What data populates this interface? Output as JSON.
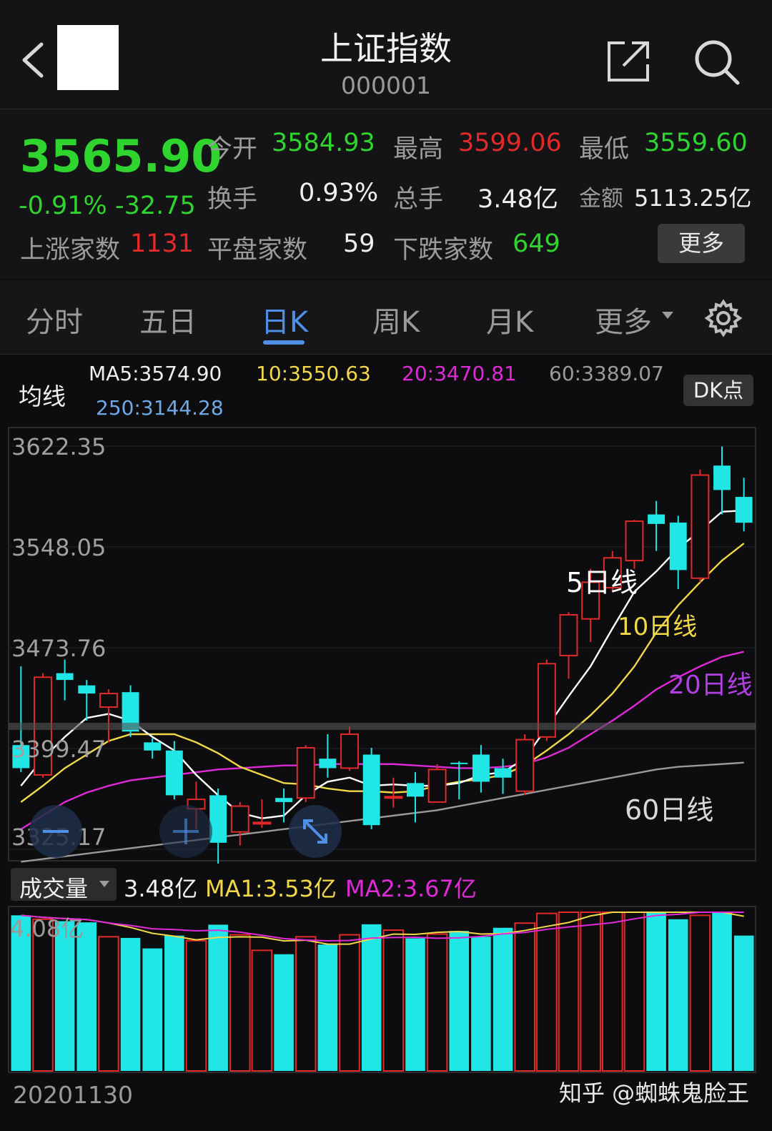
{
  "header": {
    "title": "上证指数",
    "code": "000001"
  },
  "quote": {
    "price": "3565.90",
    "change": "-0.91% -32.75",
    "open_label": "今开",
    "open": "3584.93",
    "high_label": "最高",
    "high": "3599.06",
    "low_label": "最低",
    "low": "3559.60",
    "turnover_label": "换手",
    "turnover": "0.93%",
    "volume_label": "总手",
    "volume": "3.48亿",
    "amount_label": "金额",
    "amount": "5113.25亿",
    "up_label": "上涨家数",
    "up": "1131",
    "flat_label": "平盘家数",
    "flat": "59",
    "down_label": "下跌家数",
    "down": "649",
    "more_label": "更多"
  },
  "tabs": [
    "分时",
    "五日",
    "日K",
    "周K",
    "月K",
    "更多"
  ],
  "active_tab": "日K",
  "ma": {
    "label": "均线",
    "ma5": "MA5:3574.90",
    "ma10": "10:3550.63",
    "ma20": "20:3470.81",
    "ma60": "60:3389.07",
    "ma250": "250:3144.28",
    "dk_label": "DK点"
  },
  "annotations": {
    "ma5": "5日线",
    "ma10": "10日线",
    "ma20": "20日线",
    "ma60": "60日线"
  },
  "volume_panel": {
    "selector": "成交量",
    "current": "3.48亿",
    "ma1": "MA1:3.53亿",
    "ma2": "MA2:3.67亿",
    "max_label": "4.08亿"
  },
  "date_start": "20201130",
  "watermark": "知乎 @蜘蛛鬼脸王",
  "colors": {
    "up": "#e02a2a",
    "down": "#20e6e6",
    "ma5": "#ffffff",
    "ma10": "#f0d848",
    "ma20": "#e02ad8",
    "ma60": "#9a9a9a",
    "ma250": "#6ea8e6",
    "accent": "#4f8fe6"
  },
  "chart_data": {
    "type": "candlestick",
    "y_ticks": [
      "3622.35",
      "3548.05",
      "3473.76",
      "3399.47",
      "3325.17"
    ],
    "ylim": [
      3325.17,
      3622.35
    ],
    "candles": [
      {
        "o": 3402,
        "c": 3385,
        "h": 3460,
        "l": 3382
      },
      {
        "o": 3380,
        "c": 3452,
        "h": 3455,
        "l": 3378
      },
      {
        "o": 3455,
        "c": 3450,
        "h": 3465,
        "l": 3435
      },
      {
        "o": 3446,
        "c": 3440,
        "h": 3450,
        "l": 3420
      },
      {
        "o": 3430,
        "c": 3440,
        "h": 3443,
        "l": 3404
      },
      {
        "o": 3441,
        "c": 3412,
        "h": 3446,
        "l": 3408
      },
      {
        "o": 3404,
        "c": 3398,
        "h": 3407,
        "l": 3392
      },
      {
        "o": 3398,
        "c": 3365,
        "h": 3405,
        "l": 3362
      },
      {
        "o": 3355,
        "c": 3362,
        "h": 3375,
        "l": 3340
      },
      {
        "o": 3365,
        "c": 3330,
        "h": 3370,
        "l": 3308
      },
      {
        "o": 3338,
        "c": 3357,
        "h": 3360,
        "l": 3328
      },
      {
        "o": 3345,
        "c": 3345,
        "h": 3362,
        "l": 3341
      },
      {
        "o": 3363,
        "c": 3360,
        "h": 3370,
        "l": 3345
      },
      {
        "o": 3363,
        "c": 3400,
        "h": 3402,
        "l": 3360
      },
      {
        "o": 3392,
        "c": 3385,
        "h": 3410,
        "l": 3378
      },
      {
        "o": 3385,
        "c": 3410,
        "h": 3416,
        "l": 3383
      },
      {
        "o": 3395,
        "c": 3343,
        "h": 3400,
        "l": 3340
      },
      {
        "o": 3364,
        "c": 3364,
        "h": 3378,
        "l": 3356
      },
      {
        "o": 3374,
        "c": 3364,
        "h": 3382,
        "l": 3345
      },
      {
        "o": 3360,
        "c": 3384,
        "h": 3388,
        "l": 3360
      },
      {
        "o": 3389,
        "c": 3388,
        "h": 3390,
        "l": 3362
      },
      {
        "o": 3395,
        "c": 3375,
        "h": 3402,
        "l": 3367
      },
      {
        "o": 3385,
        "c": 3378,
        "h": 3392,
        "l": 3366
      },
      {
        "o": 3368,
        "c": 3406,
        "h": 3410,
        "l": 3365
      },
      {
        "o": 3408,
        "c": 3462,
        "h": 3465,
        "l": 3405
      },
      {
        "o": 3468,
        "c": 3498,
        "h": 3500,
        "l": 3451
      },
      {
        "o": 3495,
        "c": 3522,
        "h": 3532,
        "l": 3478
      },
      {
        "o": 3518,
        "c": 3540,
        "h": 3545,
        "l": 3515
      },
      {
        "o": 3538,
        "c": 3567,
        "h": 3568,
        "l": 3532
      },
      {
        "o": 3572,
        "c": 3565,
        "h": 3582,
        "l": 3545
      },
      {
        "o": 3566,
        "c": 3531,
        "h": 3571,
        "l": 3517
      },
      {
        "o": 3525,
        "c": 3601,
        "h": 3605,
        "l": 3522
      },
      {
        "o": 3608,
        "c": 3590,
        "h": 3622,
        "l": 3572
      },
      {
        "o": 3584.93,
        "c": 3565.9,
        "h": 3599.06,
        "l": 3559.6
      }
    ],
    "volume_ylim": [
      0,
      4.08
    ],
    "volume": [
      4.0,
      3.9,
      3.85,
      3.82,
      3.45,
      3.42,
      3.15,
      3.48,
      3.35,
      3.76,
      3.5,
      3.1,
      3.0,
      3.45,
      3.25,
      3.5,
      3.77,
      3.62,
      3.41,
      3.52,
      3.6,
      3.45,
      3.68,
      3.8,
      4.05,
      4.1,
      4.3,
      4.2,
      4.4,
      4.4,
      3.9,
      4.0,
      4.1,
      3.48
    ],
    "ma5": [
      3372,
      3392,
      3408,
      3422,
      3425,
      3420,
      3408,
      3398,
      3380,
      3365,
      3352,
      3348,
      3350,
      3365,
      3375,
      3378,
      3372,
      3373,
      3372,
      3372,
      3374,
      3380,
      3382,
      3392,
      3415,
      3438,
      3460,
      3488,
      3515,
      3530,
      3547,
      3560,
      3574,
      3574.9
    ],
    "ma10": [
      3360,
      3372,
      3385,
      3395,
      3405,
      3410,
      3410,
      3410,
      3404,
      3396,
      3386,
      3380,
      3374,
      3373,
      3370,
      3368,
      3368,
      3367,
      3368,
      3372,
      3375,
      3377,
      3380,
      3387,
      3398,
      3410,
      3424,
      3440,
      3460,
      3485,
      3505,
      3522,
      3538,
      3550.63
    ],
    "ma20": [
      3340,
      3350,
      3360,
      3367,
      3372,
      3376,
      3378,
      3380,
      3382,
      3384,
      3385,
      3386,
      3387,
      3387,
      3388,
      3388,
      3388,
      3388,
      3387,
      3386,
      3385,
      3385,
      3386,
      3388,
      3393,
      3400,
      3410,
      3420,
      3431,
      3443,
      3452,
      3460,
      3467,
      3470.81
    ],
    "ma60": [
      3316,
      3318,
      3320,
      3322,
      3324,
      3326,
      3328,
      3330,
      3332,
      3334,
      3336,
      3338,
      3340,
      3342,
      3344,
      3346,
      3348,
      3350,
      3352,
      3354,
      3357,
      3360,
      3363,
      3366,
      3369,
      3372,
      3375,
      3378,
      3381,
      3384,
      3386,
      3387,
      3388,
      3389.07
    ]
  }
}
